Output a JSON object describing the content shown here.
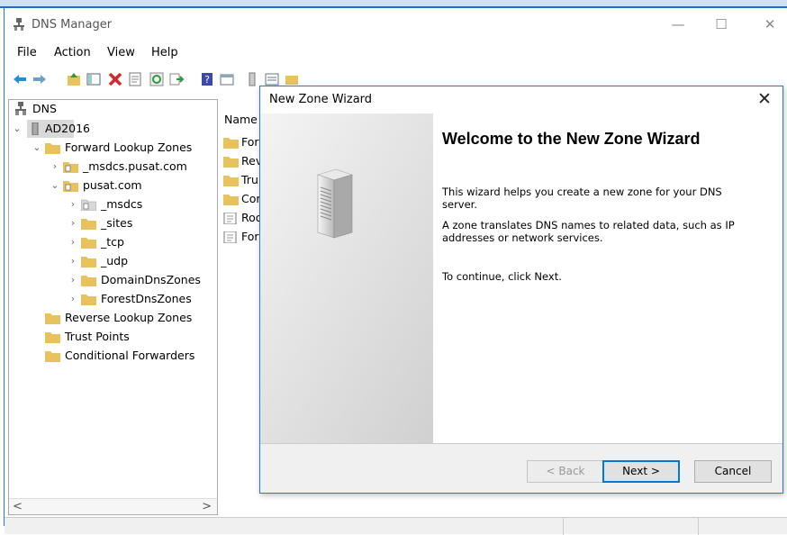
{
  "window": {
    "title": "DNS Manager",
    "minimize": "—",
    "maximize": "☐",
    "close": "✕"
  },
  "menu": [
    "File",
    "Action",
    "View",
    "Help"
  ],
  "toolbar": {
    "icons": [
      "back-arrow-icon",
      "forward-arrow-icon",
      "up-folder-icon",
      "show-hide-tree-icon",
      "delete-icon",
      "properties-icon",
      "refresh-icon",
      "export-icon",
      "help-icon",
      "console-tree-icon",
      "server-icon",
      "list-icon",
      "folder-icon"
    ]
  },
  "tree": {
    "root": "DNS",
    "server": "AD2016",
    "forward": "Forward Lookup Zones",
    "msdcs_zone": "_msdcs.pusat.com",
    "pusat": "pusat.com",
    "msdcs": "_msdcs",
    "sites": "_sites",
    "tcp": "_tcp",
    "udp": "_udp",
    "domaindns": "DomainDnsZones",
    "forestdns": "ForestDnsZones",
    "reverse": "Reverse Lookup Zones",
    "trust": "Trust Points",
    "conditional": "Conditional Forwarders"
  },
  "list": {
    "header": "Name",
    "items": [
      "For",
      "Rev",
      "Tru",
      "Cor",
      "Roo",
      "For"
    ]
  },
  "scroll": {
    "left": "<",
    "right": ">"
  },
  "dialog": {
    "title": "New Zone Wizard",
    "close": "✕",
    "heading": "Welcome to the New Zone Wizard",
    "p1": "This wizard helps you create a new zone for your DNS server.",
    "p2": "A zone translates DNS names to related data, such as IP addresses or network services.",
    "p3": "To continue, click Next.",
    "back": "< Back",
    "next": "Next >",
    "cancel": "Cancel"
  }
}
